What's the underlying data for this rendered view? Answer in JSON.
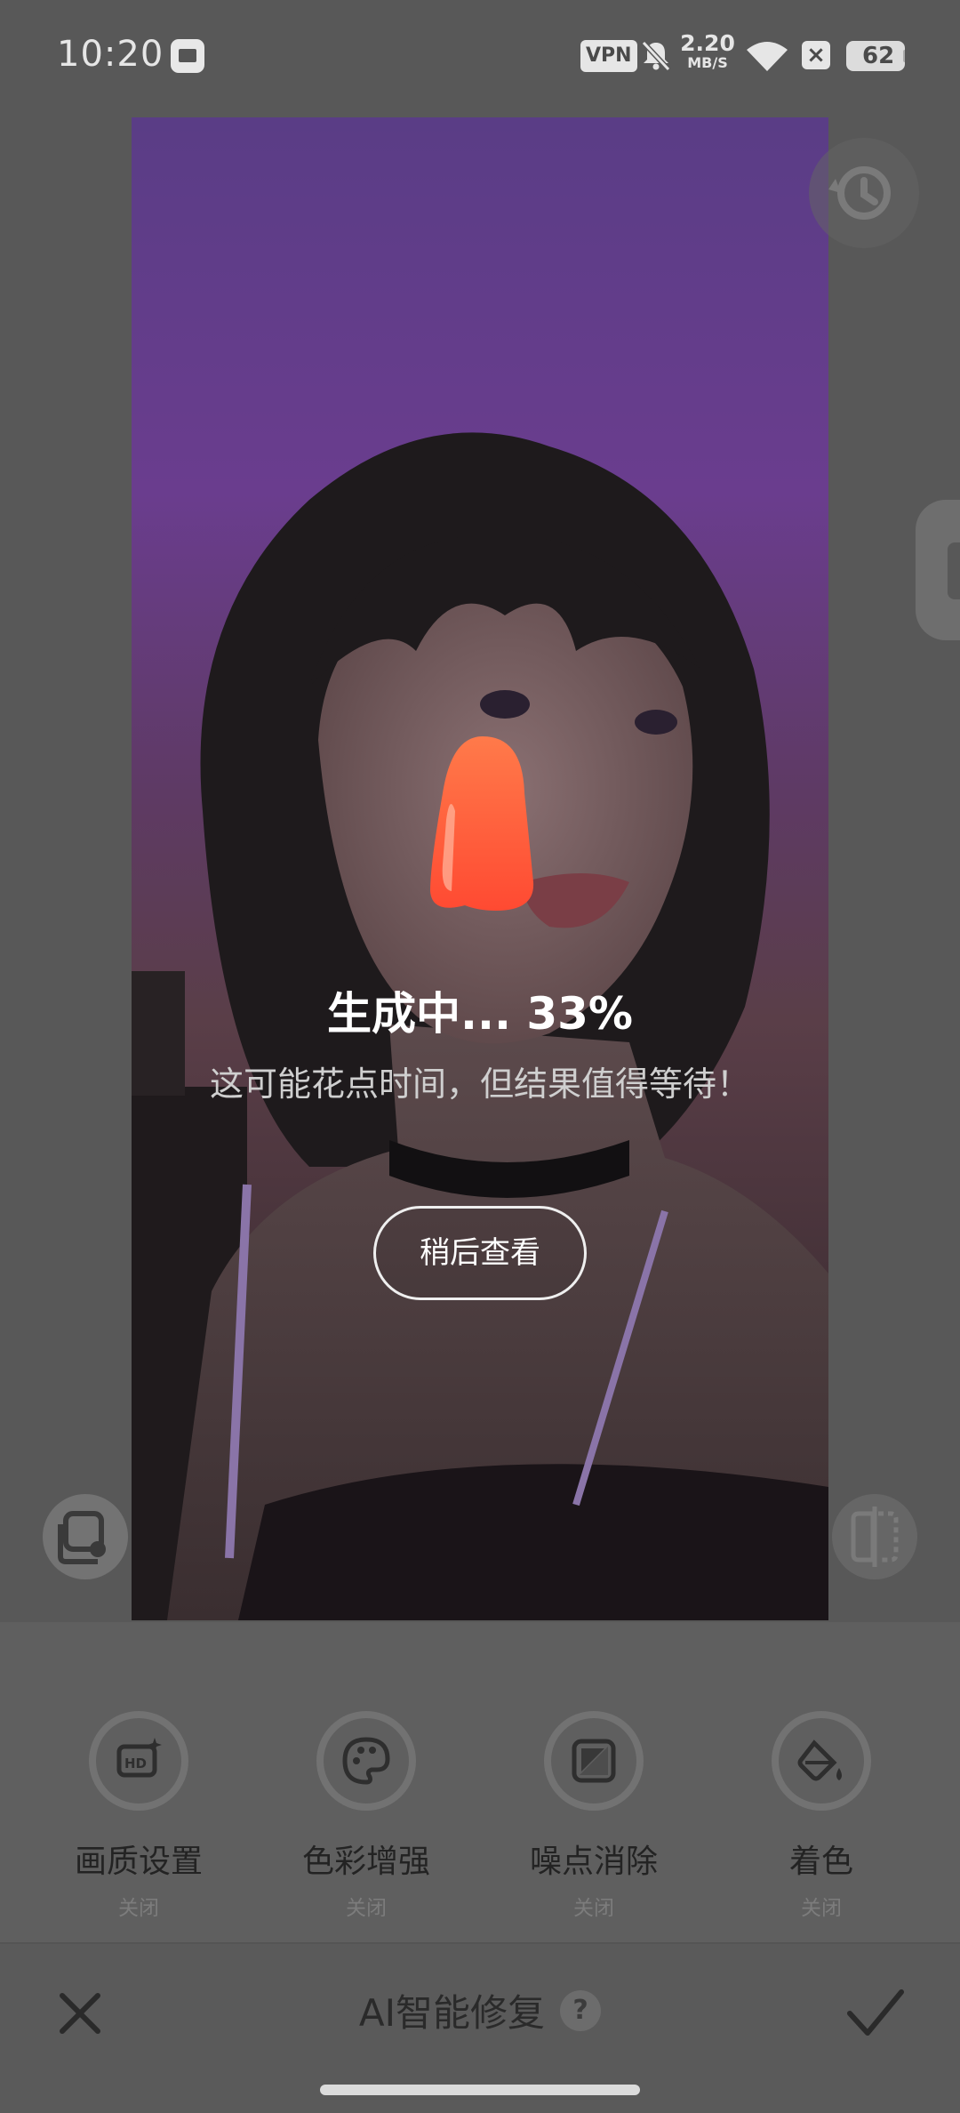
{
  "status_bar": {
    "time": "10:20",
    "vpn": "VPN",
    "net_speed": "2.20",
    "net_unit": "MB/S",
    "battery": "62"
  },
  "progress": {
    "title": "生成中... 33%",
    "percent": 33,
    "subtitle": "这可能花点时间，但结果值得等待！",
    "later_label": "稍后查看"
  },
  "tools": [
    {
      "label": "画质设置",
      "state": "关闭",
      "icon": "hd-icon"
    },
    {
      "label": "色彩增强",
      "state": "关闭",
      "icon": "palette-icon"
    },
    {
      "label": "噪点消除",
      "state": "关闭",
      "icon": "noise-icon"
    },
    {
      "label": "着色",
      "state": "关闭",
      "icon": "paint-bucket-icon"
    }
  ],
  "bottom_bar": {
    "title": "AI智能修复",
    "help": "?"
  },
  "colors": {
    "background": "#585858",
    "drop_gradient_top": "#ff7a4a",
    "drop_gradient_bottom": "#ff4a32",
    "sky_purple": "#6a3d8e"
  }
}
